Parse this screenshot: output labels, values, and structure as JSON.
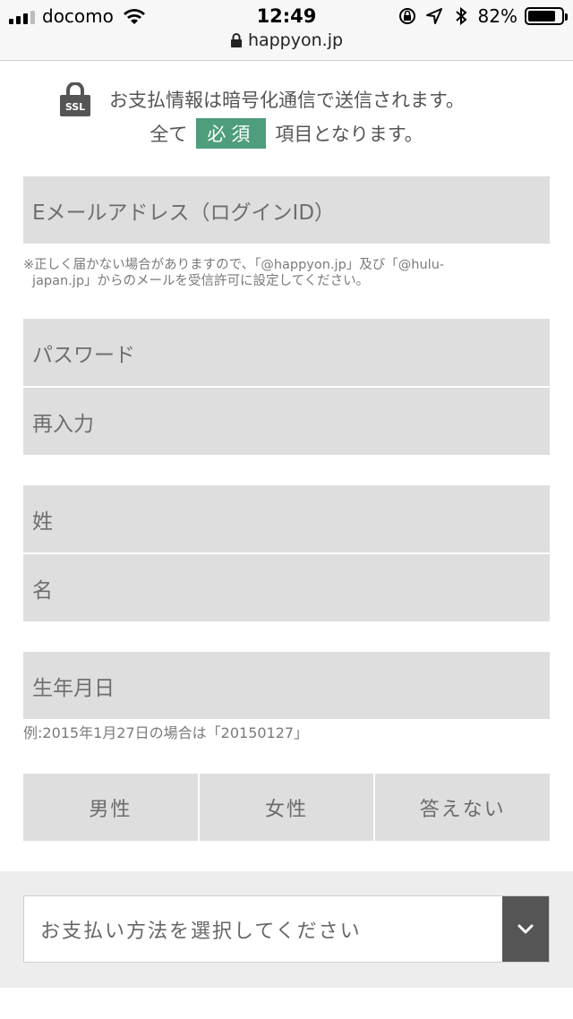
{
  "status_bar": {
    "carrier": "docomo",
    "time": "12:49",
    "battery": "82%",
    "battery_level": 0.82,
    "url": "happyon.jp"
  },
  "notice": {
    "ssl_badge": "SSL",
    "line1": "お支払情報は暗号化通信で送信されます。",
    "line2_prefix": "全て",
    "required": "必須",
    "line2_suffix": "項目となります。"
  },
  "form": {
    "email_placeholder": "Eメールアドレス（ログインID）",
    "email_hint_1": "※正しく届かない場合がありますので、「@happyon.jp」及び「@hulu-",
    "email_hint_2": "japan.jp」からのメールを受信許可に設定してください。",
    "password_placeholder": "パスワード",
    "password_confirm_placeholder": "再入力",
    "last_name_placeholder": "姓",
    "first_name_placeholder": "名",
    "birthdate_placeholder": "生年月日",
    "birthdate_hint": "例:2015年1月27日の場合は「20150127」",
    "gender": {
      "male": "男性",
      "female": "女性",
      "no_answer": "答えない"
    },
    "payment_select": "お支払い方法を選択してください"
  },
  "colors": {
    "accent": "#4e9d7c",
    "field_bg": "#dedede",
    "select_arrow_bg": "#555555"
  }
}
